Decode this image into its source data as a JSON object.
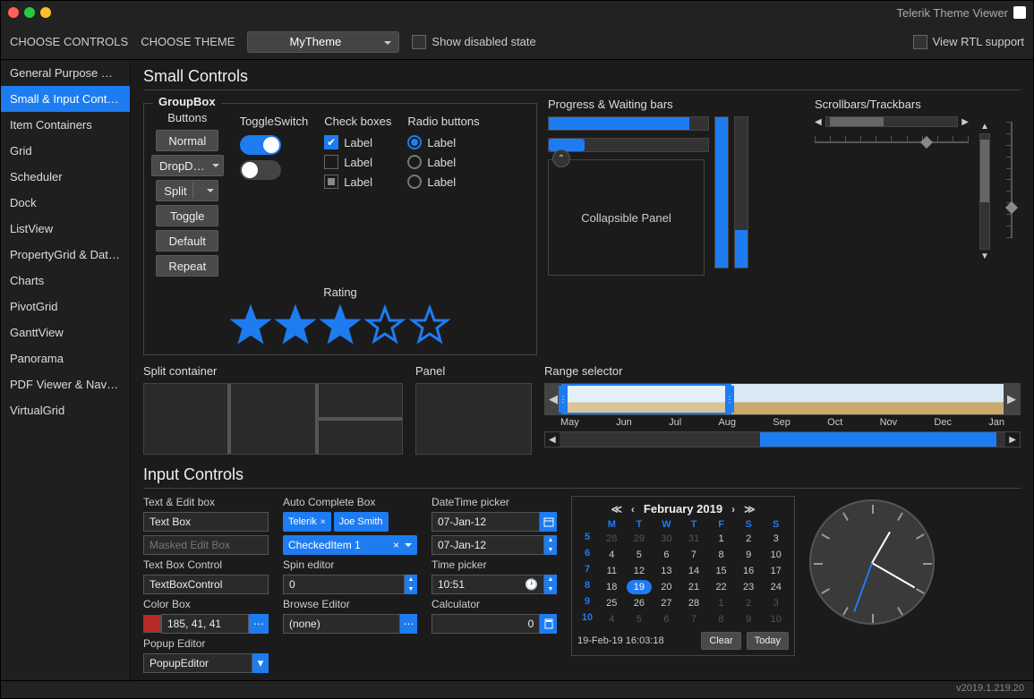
{
  "title": "Telerik Theme Viewer",
  "toolbar": {
    "choose_controls": "CHOOSE CONTROLS",
    "choose_theme": "CHOOSE THEME",
    "theme": "MyTheme",
    "show_disabled": "Show disabled state",
    "rtl": "View RTL support"
  },
  "sidebar": [
    "General Purpose C…",
    "Small & Input Contr…",
    "Item Containers",
    "Grid",
    "Scheduler",
    "Dock",
    "ListView",
    "PropertyGrid & Dat…",
    "Charts",
    "PivotGrid",
    "GanttView",
    "Panorama",
    "PDF Viewer & Navig…",
    "VirtualGrid"
  ],
  "sidebar_selected": 1,
  "sections": {
    "small": "Small Controls",
    "input": "Input Controls"
  },
  "groupbox": "GroupBox",
  "buttons": {
    "header": "Buttons",
    "normal": "Normal",
    "dropdown": "DropD…",
    "split": "Split",
    "toggle": "Toggle",
    "default": "Default",
    "repeat": "Repeat"
  },
  "toggle_header": "ToggleSwitch",
  "check_header": "Check boxes",
  "radio_header": "Radio buttons",
  "label": "Label",
  "rating_header": "Rating",
  "progress_header": "Progress & Waiting bars",
  "collapsible_text": "Collapsible Panel",
  "scrollbar_header": "Scrollbars/Trackbars",
  "split_header": "Split container",
  "panel_header": "Panel",
  "range_header": "Range selector",
  "range_months": [
    "May",
    "Jun",
    "Jul",
    "Aug",
    "Sep",
    "Oct",
    "Nov",
    "Dec",
    "Jan"
  ],
  "input_labels": {
    "textedit": "Text & Edit box",
    "textbox": "Text Box",
    "masked": "Masked Edit Box",
    "tb_control_lbl": "Text Box Control",
    "tb_control": "TextBoxControl",
    "colorbox": "Color Box",
    "color_val": "185, 41, 41",
    "popup_lbl": "Popup Editor",
    "popup_val": "PopupEditor",
    "auto_lbl": "Auto Complete Box",
    "tag1": "Telerik",
    "tag2": "Joe Smith",
    "checked_item": "CheckedItem 1",
    "spin_lbl": "Spin editor",
    "spin_val": "0",
    "browse_lbl": "Browse Editor",
    "browse_val": "(none)",
    "dt_lbl": "DateTime picker",
    "dt_val": "07-Jan-12",
    "dt_val2": "07-Jan-12",
    "time_lbl": "Time picker",
    "time_val": "10:51",
    "calc_lbl": "Calculator",
    "calc_val": "0"
  },
  "calendar": {
    "title": "February 2019",
    "dow": [
      "M",
      "T",
      "W",
      "T",
      "F",
      "S",
      "S"
    ],
    "weeks": [
      {
        "wk": "5",
        "days": [
          {
            "d": "28",
            "o": 1
          },
          {
            "d": "29",
            "o": 1
          },
          {
            "d": "30",
            "o": 1
          },
          {
            "d": "31",
            "o": 1
          },
          {
            "d": "1"
          },
          {
            "d": "2"
          },
          {
            "d": "3"
          }
        ]
      },
      {
        "wk": "6",
        "days": [
          {
            "d": "4"
          },
          {
            "d": "5"
          },
          {
            "d": "6"
          },
          {
            "d": "7"
          },
          {
            "d": "8"
          },
          {
            "d": "9"
          },
          {
            "d": "10"
          }
        ]
      },
      {
        "wk": "7",
        "days": [
          {
            "d": "11"
          },
          {
            "d": "12"
          },
          {
            "d": "13"
          },
          {
            "d": "14"
          },
          {
            "d": "15"
          },
          {
            "d": "16"
          },
          {
            "d": "17"
          }
        ]
      },
      {
        "wk": "8",
        "days": [
          {
            "d": "18"
          },
          {
            "d": "19",
            "t": 1
          },
          {
            "d": "20"
          },
          {
            "d": "21"
          },
          {
            "d": "22"
          },
          {
            "d": "23"
          },
          {
            "d": "24"
          }
        ]
      },
      {
        "wk": "9",
        "days": [
          {
            "d": "25"
          },
          {
            "d": "26"
          },
          {
            "d": "27"
          },
          {
            "d": "28"
          },
          {
            "d": "1",
            "o": 1
          },
          {
            "d": "2",
            "o": 1
          },
          {
            "d": "3",
            "o": 1
          }
        ]
      },
      {
        "wk": "10",
        "days": [
          {
            "d": "4",
            "o": 1
          },
          {
            "d": "5",
            "o": 1
          },
          {
            "d": "6",
            "o": 1
          },
          {
            "d": "7",
            "o": 1
          },
          {
            "d": "8",
            "o": 1
          },
          {
            "d": "9",
            "o": 1
          },
          {
            "d": "10",
            "o": 1
          }
        ]
      }
    ],
    "footer_time": "19-Feb-19 16:03:18",
    "clear": "Clear",
    "today": "Today"
  },
  "version": "v2019.1.219.20"
}
